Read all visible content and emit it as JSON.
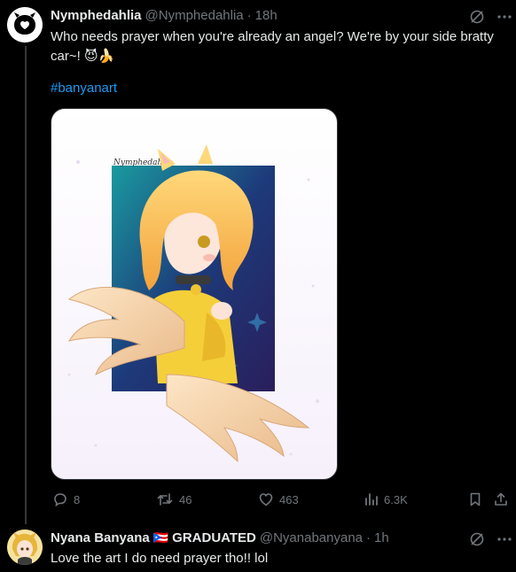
{
  "post": {
    "display_name": "Nymphedahlia",
    "handle": "@Nymphedahlia",
    "dot": "·",
    "time": "18h",
    "text": "Who needs prayer when you're already an angel? We're by your side bratty car~!",
    "emojis": "😈🍌",
    "hashtag": "#banyanart",
    "art_signature": "Nymphedahlia",
    "actions": {
      "replies": "8",
      "reposts": "46",
      "likes": "463",
      "views": "6.3K"
    }
  },
  "reply": {
    "display_name": "Nyana Banyana",
    "flag": "🇵🇷",
    "badge_text": "GRADUATED",
    "handle": "@Nyanabanyana",
    "dot": "·",
    "time": "1h",
    "text": "Love the art I do need prayer tho!! lol"
  },
  "colors": {
    "background": "#000000",
    "text": "#e7e9ea",
    "muted": "#71767b",
    "link": "#1d9bf0"
  }
}
